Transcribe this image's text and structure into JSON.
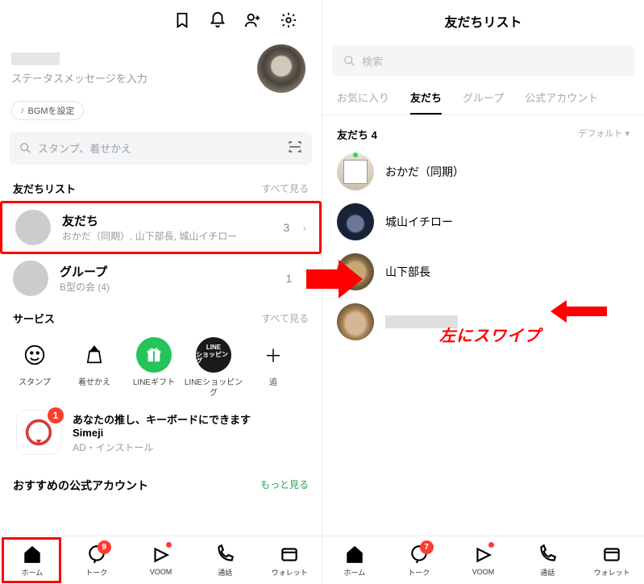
{
  "left": {
    "status_placeholder": "ステータスメッセージを入力",
    "bgm": "BGMを設定",
    "search_placeholder": "スタンプ、着せかえ",
    "friends_list_title": "友だちリスト",
    "see_all": "すべて見る",
    "friends_row": {
      "title": "友だち",
      "subtitle": "おかだ（同期）, 山下部長, 城山イチロー",
      "count": "3"
    },
    "group_row": {
      "title": "グループ",
      "subtitle": "B型の会 (4)",
      "count": "1"
    },
    "service_title": "サービス",
    "services": [
      {
        "label": "スタンプ"
      },
      {
        "label": "着せかえ"
      },
      {
        "label": "LINEギフト"
      },
      {
        "label": "LINEショッピング",
        "line1": "LINE",
        "line2": "ショッピング"
      },
      {
        "label": "追"
      }
    ],
    "ad": {
      "badge": "1",
      "title": "あなたの推し、キーボードにできます",
      "subtitle": "Simeji",
      "meta": "AD・インストール"
    },
    "recommend_title": "おすすめの公式アカウント",
    "recommend_more": "もっと見る"
  },
  "right": {
    "title": "友だちリスト",
    "search_placeholder": "検索",
    "tabs": [
      "お気に入り",
      "友だち",
      "グループ",
      "公式アカウント"
    ],
    "active_tab": 1,
    "count_label": "友だち 4",
    "sort": "デフォルト ▾",
    "friends": [
      {
        "name": "おかだ（同期）",
        "cls": "okada",
        "online": true
      },
      {
        "name": "城山イチロー",
        "cls": "shiro"
      },
      {
        "name": "山下部長",
        "cls": "yama"
      },
      {
        "name": "",
        "cls": "cat",
        "hidden": true
      }
    ]
  },
  "annotation": {
    "swipe": "左にスワイプ"
  },
  "tabs": [
    {
      "label": "ホーム",
      "icon": "home"
    },
    {
      "label": "トーク",
      "icon": "talk",
      "badge": "9"
    },
    {
      "label": "VOOM",
      "icon": "voom",
      "dot": true
    },
    {
      "label": "通話",
      "icon": "call"
    },
    {
      "label": "ウォレット",
      "icon": "wallet"
    }
  ],
  "tabs_right_badge": "7"
}
